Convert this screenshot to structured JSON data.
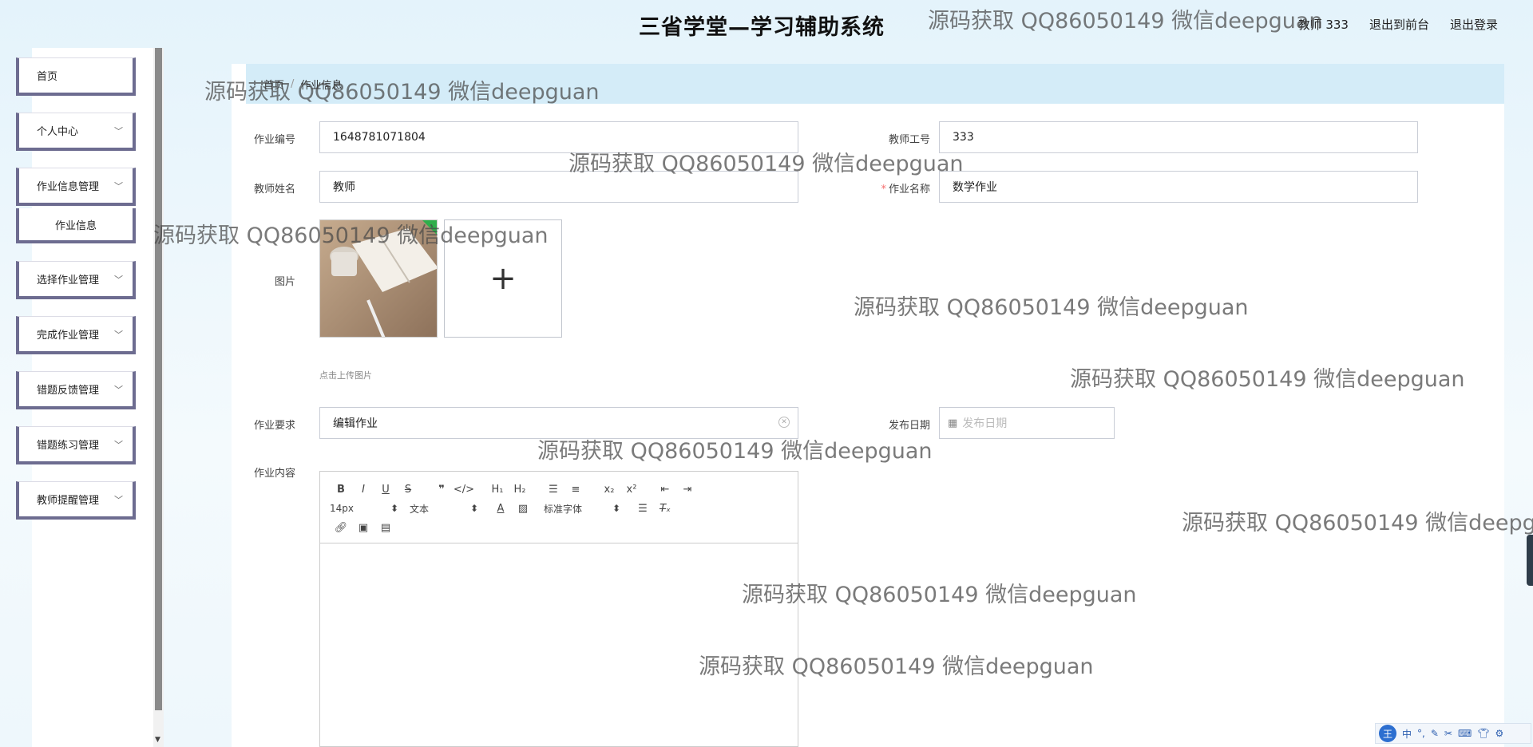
{
  "header": {
    "title": "三省学堂—学习辅助系统",
    "user_label": "教师 333",
    "front_link": "退出到前台",
    "logout_link": "退出登录"
  },
  "sidebar": {
    "items": [
      {
        "label": "首页"
      },
      {
        "label": "个人中心"
      },
      {
        "label": "作业信息管理"
      },
      {
        "label": "作业信息"
      },
      {
        "label": "选择作业管理"
      },
      {
        "label": "完成作业管理"
      },
      {
        "label": "错题反馈管理"
      },
      {
        "label": "错题练习管理"
      },
      {
        "label": "教师提醒管理"
      }
    ]
  },
  "breadcrumb": {
    "home": "首页",
    "separator": "/",
    "current": "作业信息"
  },
  "form": {
    "homework_no_label": "作业编号",
    "homework_no_value": "1648781071804",
    "teacher_no_label": "教师工号",
    "teacher_no_value": "333",
    "teacher_name_label": "教师姓名",
    "teacher_name_value": "教师",
    "homework_name_label": "作业名称",
    "homework_name_value": "数学作业",
    "image_label": "图片",
    "upload_hint": "点击上传图片",
    "requirement_label": "作业要求",
    "requirement_value": "编辑作业",
    "publish_date_label": "发布日期",
    "publish_date_placeholder": "发布日期",
    "content_label": "作业内容"
  },
  "editor": {
    "font_size": "14px",
    "text_style": "文本",
    "font_family": "标准字体"
  },
  "watermark": "源码获取 QQ86050149 微信deepguan",
  "ime": {
    "lang": "中"
  }
}
